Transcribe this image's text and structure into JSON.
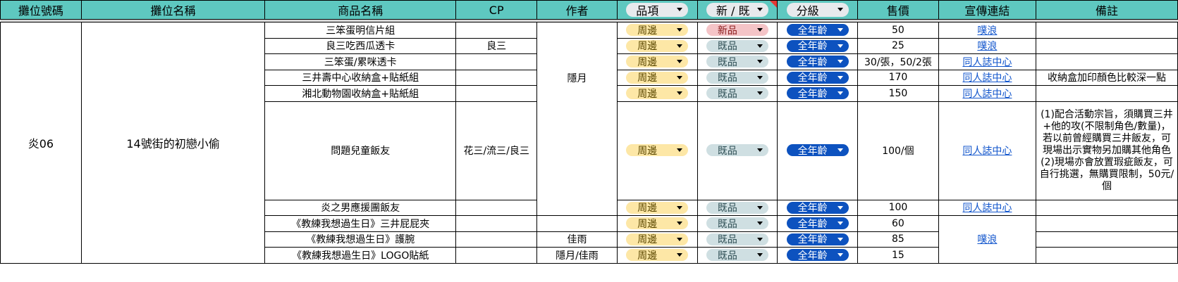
{
  "headers": {
    "booth_id": "攤位號碼",
    "booth_name": "攤位名稱",
    "product_name": "商品名稱",
    "cp": "CP",
    "author": "作者",
    "category": "品項",
    "new_old": "新 / 既",
    "rating": "分級",
    "price": "售價",
    "promo_link": "宣傳連結",
    "note": "備註"
  },
  "booth": {
    "id": "炎06",
    "name": "14號街的初戀小偷"
  },
  "authors": {
    "main": "隱月",
    "ji": "佳雨",
    "both": "隱月/佳雨"
  },
  "cps": {
    "liang": "良三",
    "multi": "花三/流三/良三",
    "empty": ""
  },
  "chip_labels": {
    "category": "周邊",
    "new": "新品",
    "old": "既品",
    "rating": "全年齡"
  },
  "links": {
    "plurk": "噗浪",
    "doujin": "同人誌中心"
  },
  "colors": {
    "header_bg": "#5ec8c0",
    "chip_category": "#fde7a6",
    "chip_new": "#f4c4c7",
    "chip_old": "#cfdfe2",
    "chip_rating": "#0d52bf",
    "link": "#1155cc"
  },
  "rows": [
    {
      "product": "三笨蛋明信片組",
      "price": "50",
      "note": ""
    },
    {
      "product": "良三吃西瓜透卡",
      "price": "25",
      "note": ""
    },
    {
      "product": "三笨蛋/累咪透卡",
      "price": "30/張，50/2張",
      "note": ""
    },
    {
      "product": "三井壽中心收納盒+貼紙組",
      "price": "170",
      "note": "收納盒加印顏色比較深一點"
    },
    {
      "product": "湘北動物園收納盒+貼紙組",
      "price": "150",
      "note": ""
    },
    {
      "product": "問題兒童飯友",
      "price": "100/個",
      "note": "(1)配合活動宗旨，須購買三井+他的攻(不限制角色/數量)，若以前曾經購買三井飯友，可現場出示實物另加購其他角色\n(2)現場亦會放置瑕疵飯友，可自行挑選，無購買限制，50元/個"
    },
    {
      "product": "炎之男應援團飯友",
      "price": "100",
      "note": ""
    },
    {
      "product": "《教練我想過生日》三井屁屁夾",
      "price": "60",
      "note": ""
    },
    {
      "product": "《教練我想過生日》護腕",
      "price": "85",
      "note": ""
    },
    {
      "product": "《教練我想過生日》LOGO貼紙",
      "price": "15",
      "note": ""
    }
  ]
}
